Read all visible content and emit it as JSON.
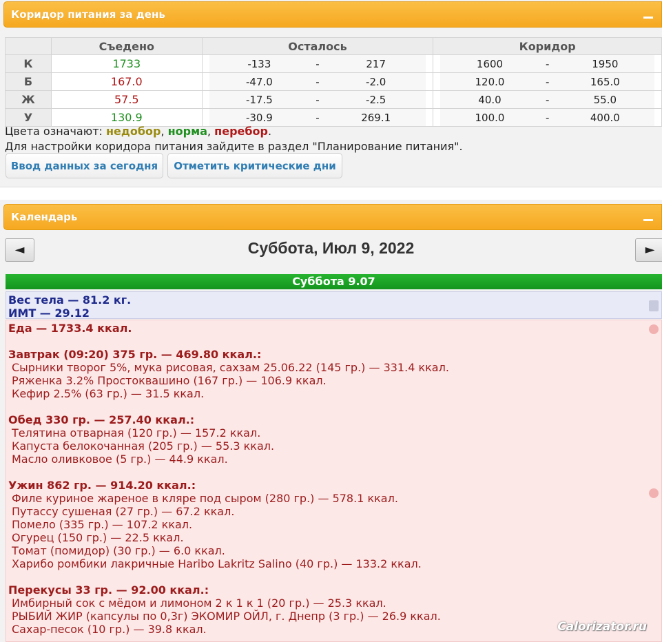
{
  "corridor_panel": {
    "title": "Коридор питания за день",
    "headers": {
      "eaten": "Съедено",
      "remaining": "Осталось",
      "corridor": "Коридор"
    },
    "rows": [
      {
        "label": "К",
        "eaten": "1733",
        "eaten_status": "норма",
        "remaining_min": "-133",
        "remaining_max": "217",
        "corridor_min": "1600",
        "corridor_max": "1950"
      },
      {
        "label": "Б",
        "eaten": "167.0",
        "eaten_status": "перебор",
        "remaining_min": "-47.0",
        "remaining_max": "-2.0",
        "corridor_min": "120.0",
        "corridor_max": "165.0"
      },
      {
        "label": "Ж",
        "eaten": "57.5",
        "eaten_status": "перебор",
        "remaining_min": "-17.5",
        "remaining_max": "-2.5",
        "corridor_min": "40.0",
        "corridor_max": "55.0"
      },
      {
        "label": "У",
        "eaten": "130.9",
        "eaten_status": "норма",
        "remaining_min": "-30.9",
        "remaining_max": "269.1",
        "corridor_min": "100.0",
        "corridor_max": "400.0"
      }
    ],
    "dash": "-",
    "legend": {
      "prefix": "Цвета означают: ",
      "under": "недобор",
      "sep1": ", ",
      "norm": "норма",
      "sep2": ", ",
      "over": "перебор",
      "end": "."
    },
    "hint": "Для настройки коридора питания зайдите в раздел \"Планирование питания\".",
    "buttons": {
      "today": "Ввод данных за сегодня",
      "critical": "Отметить критические дни"
    },
    "colors": {
      "norm": "#1f8f1f",
      "over": "#b01818",
      "under": "#9a8b10"
    }
  },
  "calendar_panel": {
    "title": "Календарь",
    "date_title": "Суббота, Июл 9, 2022",
    "prev": "◄",
    "next": "►",
    "day_bar": "Суббота 9.07",
    "weight": "Вес тела — 81.2 кг.",
    "bmi": "ИМТ — 29.12",
    "food_total": "Еда — 1733.4 ккал.",
    "meals": [
      {
        "title": "Завтрак (09:20) 375 гр. — 469.80 ккал.:",
        "items": [
          "Сырники творог 5%, мука рисовая, сахзам 25.06.22 (145 гр.) — 331.4 ккал.",
          "Ряженка 3.2% Простоквашино (167 гр.) — 106.9 ккал.",
          "Кефир 2.5% (63 гр.) — 31.5 ккал."
        ]
      },
      {
        "title": "Обед 330 гр. — 257.40 ккал.:",
        "items": [
          "Телятина отварная (120 гр.) — 157.2 ккал.",
          "Капуста белокочанная (205 гр.) — 55.3 ккал.",
          "Масло оливковое (5 гр.) — 44.9 ккал."
        ]
      },
      {
        "title": "Ужин 862 гр. — 914.20 ккал.:",
        "items": [
          "Филе куриное жареное в кляре под сыром (280 гр.) — 578.1 ккал.",
          "Путассу сушеная (27 гр.) — 67.2 ккал.",
          "Помело (335 гр.) — 107.2 ккал.",
          "Огурец (150 гр.) — 22.5 ккал.",
          "Томат (помидор) (30 гр.) — 6.0 ккал.",
          "Харибо ромбики лакричные Haribo Lakritz Salino (40 гр.) — 133.2 ккал."
        ]
      },
      {
        "title": "Перекусы 33 гр. — 92.00 ккал.:",
        "items": [
          "Имбирный сок с мёдом и лимоном 2 к 1 к 1 (20 гр.) — 25.3 ккал.",
          "РЫБИЙ ЖИР (капсулы по 0,3г) ЭКОМИР ОЙЛ, г. Днепр (3 гр.) — 26.9 ккал.",
          "Сахар-песок (10 гр.) — 39.8 ккал."
        ]
      }
    ],
    "watermark": "Calorizator.ru"
  }
}
